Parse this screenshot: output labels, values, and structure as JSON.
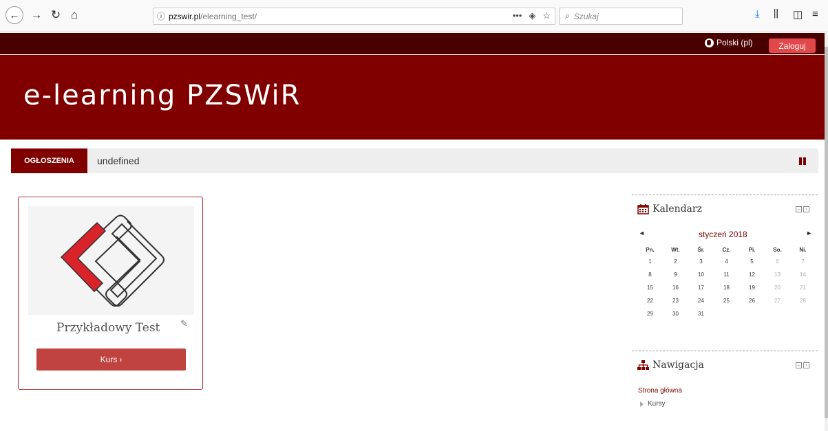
{
  "browser": {
    "url_host": "pzswir.pl",
    "url_path": "/elearning_test/",
    "search_placeholder": "Szukaj"
  },
  "topbar": {
    "language": "Polski (pl)",
    "login": "Zaloguj"
  },
  "banner": {
    "title": "e-learning PZSWiR"
  },
  "announcements": {
    "label": "OGŁOSZENIA",
    "text": "undefined"
  },
  "course": {
    "title": "Przykładowy Test",
    "button": "Kurs",
    "button_arrow": "›"
  },
  "calendar": {
    "title": "Kalendarz",
    "month": "styczeń 2018",
    "prev": "◄",
    "next": "►",
    "weekdays": [
      "Pn.",
      "Wt.",
      "Śr.",
      "Cz.",
      "Pi.",
      "So.",
      "Ni."
    ],
    "weeks": [
      [
        "1",
        "2",
        "3",
        "4",
        "5",
        "6",
        "7"
      ],
      [
        "8",
        "9",
        "10",
        "11",
        "12",
        "13",
        "14"
      ],
      [
        "15",
        "16",
        "17",
        "18",
        "19",
        "20",
        "21"
      ],
      [
        "22",
        "23",
        "24",
        "25",
        "26",
        "27",
        "28"
      ],
      [
        "29",
        "30",
        "31",
        "",
        "",
        "",
        ""
      ]
    ]
  },
  "navigation": {
    "title": "Nawigacja",
    "home": "Strona główna",
    "courses": "Kursy"
  },
  "colors": {
    "brand": "#800000",
    "dark": "#4b0000",
    "login": "#e2474a",
    "course_button": "#c04340"
  }
}
